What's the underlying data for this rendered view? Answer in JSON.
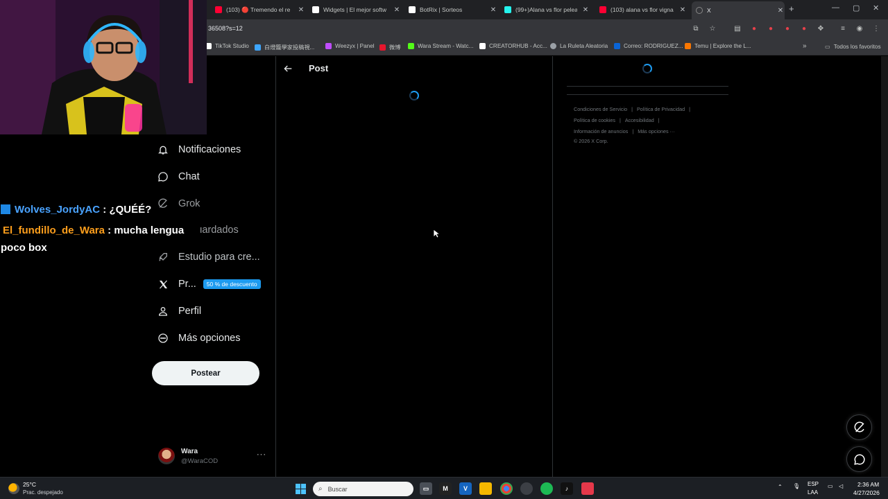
{
  "browser": {
    "tabs": [
      {
        "title": "(103) 🔴 Tremendo el re",
        "favicon_color": "#ff0033"
      },
      {
        "title": "Widgets | El mejor softw",
        "favicon_color": "#ffffff"
      },
      {
        "title": "BotRix | Sorteos",
        "favicon_color": "#ffffff"
      },
      {
        "title": "(99+)Alana vs flor pelea d",
        "favicon_color": "#25f4ee"
      },
      {
        "title": "(103) alana vs flor vigna p",
        "favicon_color": "#ff0033"
      },
      {
        "title": "X",
        "favicon_color": "#888888"
      }
    ],
    "new_tab": "+",
    "window_controls": {
      "minimize": "—",
      "maximize": "▢",
      "close": "✕"
    },
    "url": "36508?s=12",
    "bookmarks": [
      {
        "label": "TikTok Studio",
        "color": "#ffffff"
      },
      {
        "label": "白燈籠學家投稿視...",
        "color": "#3ea6ff"
      },
      {
        "label": "Weezyx | Panel",
        "color": "#c04dff"
      },
      {
        "label": "微博",
        "color": "#e6162d"
      },
      {
        "label": "Wara Stream - Watc...",
        "color": "#53fc18"
      },
      {
        "label": "CREATORHUB - Acc...",
        "color": "#ffffff"
      },
      {
        "label": "La Ruleta Aleatoria",
        "color": "#9aa0a6"
      },
      {
        "label": "Correo: RODRIGUEZ...",
        "color": "#0a64d6"
      },
      {
        "label": "Temu | Explore the L...",
        "color": "#fb7701"
      }
    ],
    "bookmarks_more": "»",
    "all_bookmarks": "Todos los favoritos"
  },
  "sidebar": {
    "partial_item": "ar",
    "items": [
      {
        "label": "Notificaciones",
        "icon": "bell-icon"
      },
      {
        "label": "Chat",
        "icon": "chat-icon"
      },
      {
        "label": "Grok",
        "icon": "grok-icon"
      },
      {
        "label": "Guardados",
        "icon": "bookmark-icon"
      },
      {
        "label": "Estudio para cre...",
        "icon": "rocket-icon"
      },
      {
        "label": "Pr...",
        "icon": "x-logo-icon",
        "badge": "50 % de descuento"
      },
      {
        "label": "Perfil",
        "icon": "person-icon"
      },
      {
        "label": "Más opciones",
        "icon": "more-circle-icon"
      }
    ],
    "post_button": "Postear",
    "account": {
      "name": "Wara",
      "handle": "@WaraCOD",
      "more": "···"
    }
  },
  "main": {
    "title": "Post"
  },
  "right": {
    "footer": {
      "terms": "Condiciones de Servicio",
      "privacy": "Política de Privacidad",
      "cookies": "Política de cookies",
      "accessibility": "Accesibilidad",
      "ads": "Información de anuncios",
      "more": "Más opciones ···",
      "copyright": "© 2026 X Corp."
    }
  },
  "overlay": {
    "chat": [
      {
        "user": "Wolves_JordyAC",
        "text": ": ¿QUÉÉ?"
      },
      {
        "user": "El_fundillo_de_Wara",
        "text": ": mucha lengua",
        "continuation": "poco box"
      }
    ]
  },
  "taskbar": {
    "weather": {
      "temp": "25°C",
      "desc": "Prac. despejado"
    },
    "search_placeholder": "Buscar",
    "apps": [
      {
        "label": "M",
        "color": "#222222"
      },
      {
        "label": "V",
        "color": "#1565c0"
      }
    ],
    "lang": {
      "top": "ESP",
      "bottom": "LAA"
    },
    "time": "2:36 AM",
    "date": "4/27/2026"
  }
}
